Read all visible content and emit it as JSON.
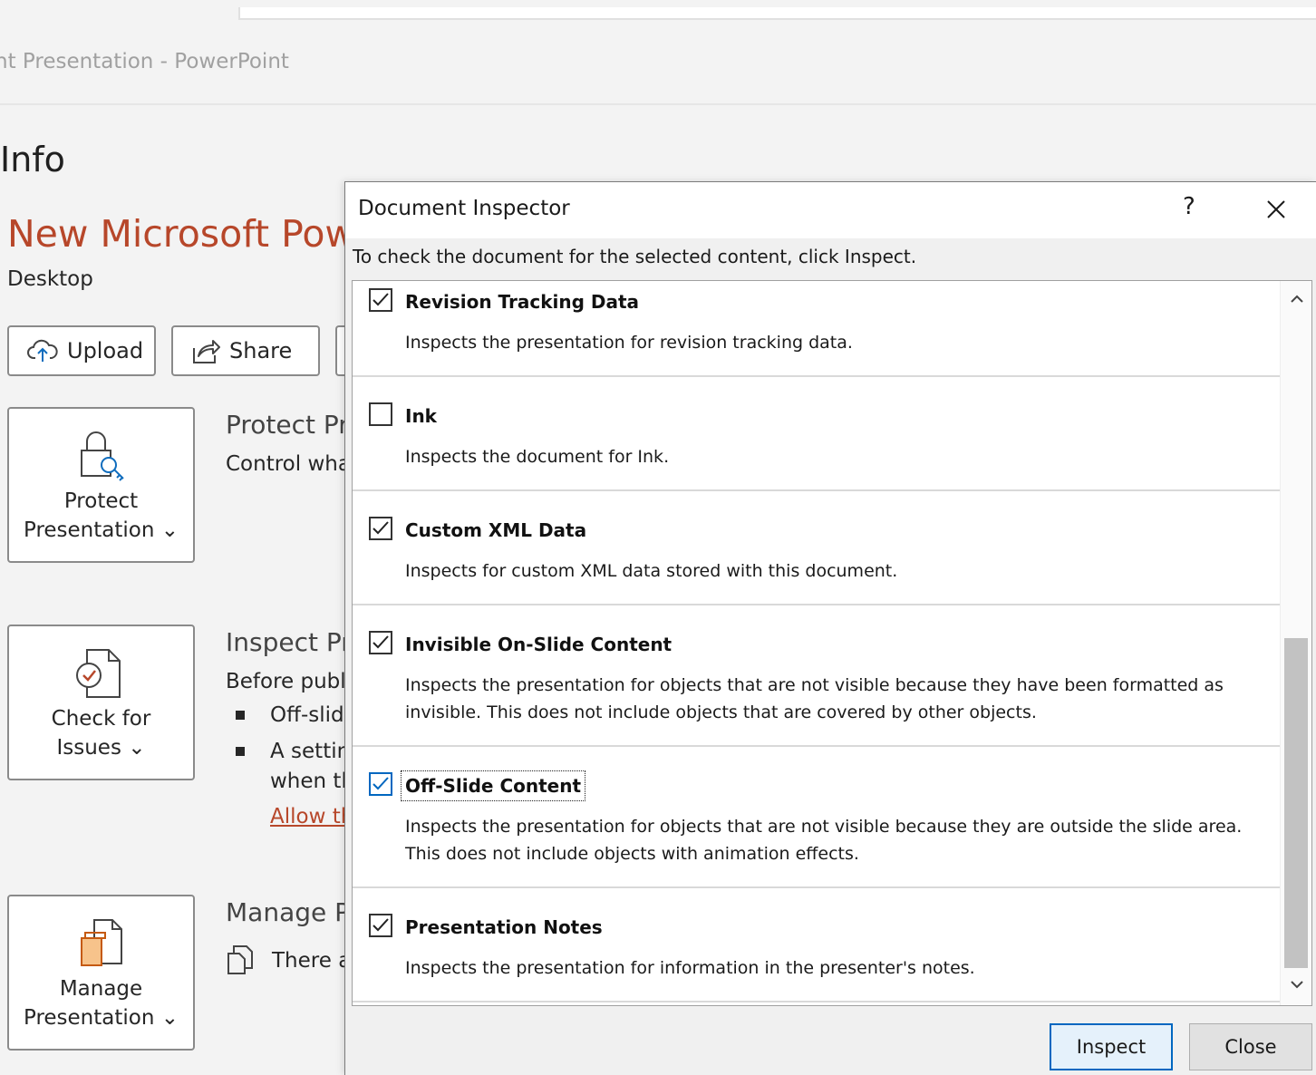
{
  "window": {
    "title": "nt Presentation  -  PowerPoint"
  },
  "backstage": {
    "page_title": "Info",
    "doc_title": "New Microsoft Powe",
    "doc_location": "Desktop",
    "actions": [
      {
        "label": "Upload",
        "icon": "upload-cloud-icon"
      },
      {
        "label": "Share",
        "icon": "share-icon"
      }
    ],
    "sections": {
      "protect": {
        "button_label": "Protect Presentation",
        "button_line1": "Protect",
        "button_line2": "Presentation ⌄",
        "heading": "Protect Pr",
        "text": "Control what"
      },
      "inspect": {
        "button_line1": "Check for",
        "button_line2": "Issues ⌄",
        "heading": "Inspect Pr",
        "text": "Before publi",
        "bullets": [
          "Off-slid",
          "A settin"
        ],
        "bullet2_cont": "when th",
        "link": "Allow th"
      },
      "manage": {
        "button_line1": "Manage",
        "button_line2": "Presentation ⌄",
        "heading": "Manage P",
        "text": "There a"
      }
    }
  },
  "dialog": {
    "title": "Document Inspector",
    "help": "?",
    "instruction": "To check the document for the selected content, click Inspect.",
    "items": [
      {
        "label": "Revision Tracking Data",
        "checked": true,
        "desc": "Inspects the presentation for revision tracking data."
      },
      {
        "label": "Ink",
        "checked": false,
        "desc": "Inspects the document for Ink."
      },
      {
        "label": "Custom XML Data",
        "checked": true,
        "desc": "Inspects for custom XML data stored with this document."
      },
      {
        "label": "Invisible On-Slide Content",
        "checked": true,
        "desc": "Inspects the presentation for objects that are not visible because they have been formatted as invisible. This does not include objects that are covered by other objects."
      },
      {
        "label": "Off-Slide Content",
        "checked": true,
        "desc": "Inspects the presentation for objects that are not visible because they are outside the slide area. This does not include objects with animation effects."
      },
      {
        "label": "Presentation Notes",
        "checked": true,
        "desc": "Inspects the presentation for information in the presenter's notes."
      }
    ],
    "buttons": {
      "inspect": "Inspect",
      "close": "Close"
    }
  }
}
